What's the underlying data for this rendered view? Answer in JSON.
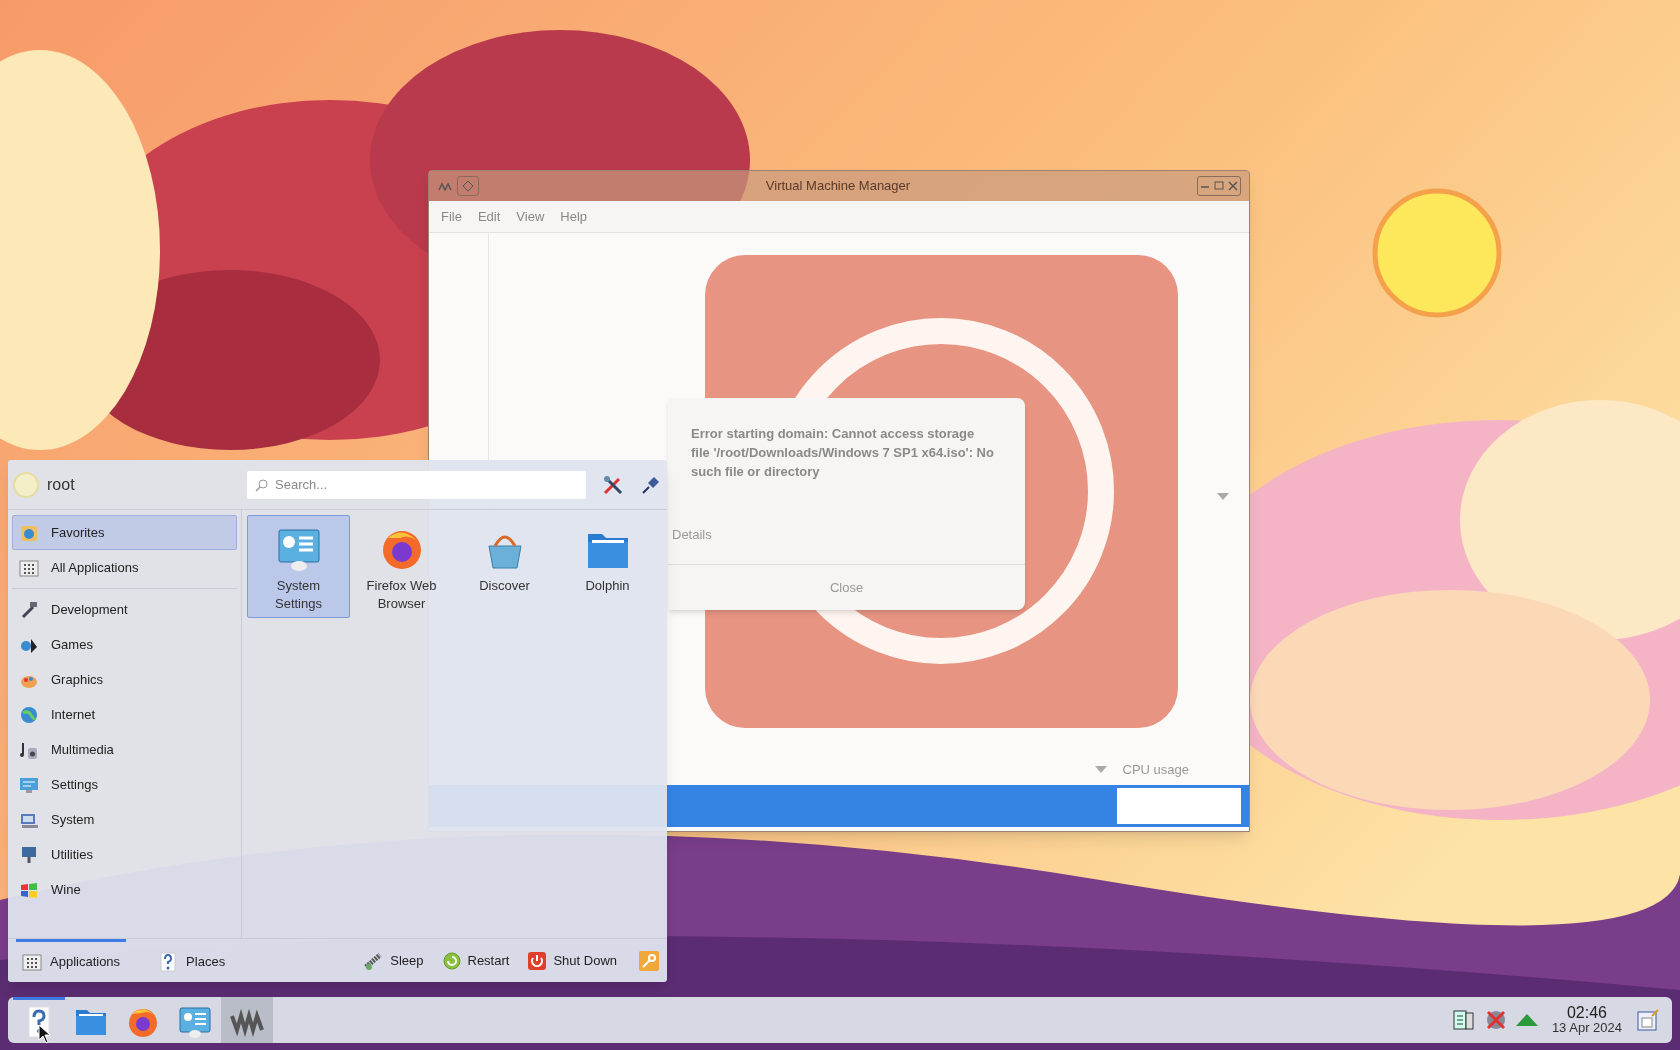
{
  "vm_window": {
    "title": "Virtual Machine Manager",
    "menu": [
      "File",
      "Edit",
      "View",
      "Help"
    ],
    "column_header": "CPU usage",
    "rows": [
      {
        "selected": true
      }
    ]
  },
  "error_dialog": {
    "message": "Error starting domain: Cannot access storage file '/root/Downloads/Windows 7 SP1 x64.iso': No such file or directory",
    "details": "Details",
    "button": "Close"
  },
  "app_menu": {
    "user": "root",
    "search": {
      "placeholder": "Search..."
    },
    "views": [
      {
        "label": "Favorites",
        "selected": true
      },
      {
        "label": "All Applications",
        "selected": false
      }
    ],
    "categories": [
      {
        "label": "Development"
      },
      {
        "label": "Games"
      },
      {
        "label": "Graphics"
      },
      {
        "label": "Internet"
      },
      {
        "label": "Multimedia"
      },
      {
        "label": "Settings"
      },
      {
        "label": "System"
      },
      {
        "label": "Utilities"
      },
      {
        "label": "Wine"
      }
    ],
    "apps": [
      {
        "label": "System Settings",
        "selected": true
      },
      {
        "label": "Firefox Web Browser",
        "selected": false
      },
      {
        "label": "Discover",
        "selected": false
      },
      {
        "label": "Dolphin",
        "selected": false
      }
    ],
    "tabs": [
      {
        "label": "Applications",
        "selected": true
      },
      {
        "label": "Places",
        "selected": false
      }
    ],
    "actions": [
      "Sleep",
      "Restart",
      "Shut Down"
    ]
  },
  "taskbar": {
    "tasks": [
      {
        "kind": "help",
        "active": true,
        "selected": false
      },
      {
        "kind": "folder",
        "active": false,
        "selected": false
      },
      {
        "kind": "browser",
        "active": false,
        "selected": false
      },
      {
        "kind": "settings",
        "active": false,
        "selected": false
      },
      {
        "kind": "vm",
        "active": false,
        "selected": true
      }
    ],
    "clock": {
      "time": "02:46",
      "date": "13 Apr 2024"
    }
  }
}
